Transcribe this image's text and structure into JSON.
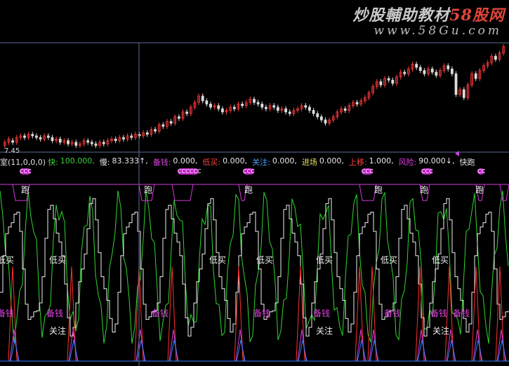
{
  "watermark": {
    "main_text": "炒股輔助教材",
    "brand_text": "58股网",
    "url": "www.58Gu.com"
  },
  "price_panel": {
    "min_label": "7.45",
    "candles_open_close": [
      [
        10,
        12
      ],
      [
        12,
        14
      ],
      [
        13,
        12
      ],
      [
        12,
        15
      ],
      [
        15,
        16
      ],
      [
        16,
        15
      ],
      [
        15,
        17
      ],
      [
        17,
        16
      ],
      [
        16,
        15
      ],
      [
        15,
        14
      ],
      [
        14,
        16
      ],
      [
        16,
        15
      ],
      [
        15,
        13
      ],
      [
        13,
        14
      ],
      [
        14,
        12
      ],
      [
        12,
        13
      ],
      [
        13,
        11
      ],
      [
        11,
        12
      ],
      [
        12,
        10
      ],
      [
        10,
        11
      ],
      [
        11,
        13
      ],
      [
        13,
        12
      ],
      [
        12,
        11
      ],
      [
        11,
        10
      ],
      [
        10,
        12
      ],
      [
        12,
        11
      ],
      [
        11,
        13
      ],
      [
        13,
        14
      ],
      [
        14,
        13
      ],
      [
        13,
        15
      ],
      [
        15,
        14
      ],
      [
        14,
        16
      ],
      [
        16,
        15
      ],
      [
        15,
        17
      ],
      [
        17,
        16
      ],
      [
        16,
        18
      ],
      [
        18,
        17
      ],
      [
        17,
        20
      ],
      [
        20,
        19
      ],
      [
        19,
        23
      ],
      [
        23,
        22
      ],
      [
        22,
        25
      ],
      [
        25,
        24
      ],
      [
        24,
        28
      ],
      [
        28,
        27
      ],
      [
        27,
        31
      ],
      [
        31,
        30
      ],
      [
        30,
        34
      ],
      [
        34,
        37
      ],
      [
        37,
        41
      ],
      [
        41,
        38
      ],
      [
        38,
        36
      ],
      [
        36,
        34
      ],
      [
        34,
        35
      ],
      [
        35,
        33
      ],
      [
        33,
        31
      ],
      [
        31,
        32
      ],
      [
        32,
        34
      ],
      [
        34,
        33
      ],
      [
        33,
        36
      ],
      [
        36,
        35
      ],
      [
        35,
        37
      ],
      [
        37,
        39
      ],
      [
        39,
        37
      ],
      [
        37,
        36
      ],
      [
        36,
        34
      ],
      [
        34,
        33
      ],
      [
        33,
        35
      ],
      [
        35,
        34
      ],
      [
        34,
        32
      ],
      [
        32,
        33
      ],
      [
        33,
        31
      ],
      [
        31,
        30
      ],
      [
        30,
        32
      ],
      [
        32,
        33
      ],
      [
        33,
        35
      ],
      [
        35,
        34
      ],
      [
        34,
        32
      ],
      [
        32,
        30
      ],
      [
        30,
        28
      ],
      [
        28,
        26
      ],
      [
        26,
        24
      ],
      [
        24,
        26
      ],
      [
        26,
        28
      ],
      [
        28,
        31
      ],
      [
        31,
        33
      ],
      [
        33,
        32
      ],
      [
        32,
        35
      ],
      [
        35,
        37
      ],
      [
        37,
        36
      ],
      [
        36,
        38
      ],
      [
        38,
        40
      ],
      [
        40,
        43
      ],
      [
        43,
        47
      ],
      [
        47,
        50
      ],
      [
        50,
        48
      ],
      [
        48,
        52
      ],
      [
        52,
        51
      ],
      [
        51,
        49
      ],
      [
        49,
        53
      ],
      [
        53,
        56
      ],
      [
        56,
        55
      ],
      [
        55,
        58
      ],
      [
        58,
        61
      ],
      [
        61,
        59
      ],
      [
        59,
        57
      ],
      [
        57,
        55
      ],
      [
        55,
        58
      ],
      [
        58,
        56
      ],
      [
        56,
        54
      ],
      [
        54,
        57
      ],
      [
        57,
        60
      ],
      [
        60,
        58
      ],
      [
        58,
        55
      ],
      [
        55,
        42
      ],
      [
        42,
        45
      ],
      [
        45,
        40
      ],
      [
        40,
        48
      ],
      [
        48,
        55
      ],
      [
        55,
        52
      ],
      [
        52,
        57
      ],
      [
        57,
        60
      ],
      [
        60,
        62
      ],
      [
        62,
        66
      ],
      [
        66,
        64
      ],
      [
        64,
        68
      ],
      [
        68,
        72
      ]
    ]
  },
  "header": {
    "items": [
      {
        "label": "室(11,0,0,0)",
        "value": "",
        "color": "#e0e0e0"
      },
      {
        "label": "快:",
        "value": "100.000,",
        "color": "#3fd13f"
      },
      {
        "label": "慢:",
        "value": "83.333↑,",
        "color": "#e8e8e8"
      },
      {
        "label": "备钱:",
        "value": "0.000,",
        "color": "#e040e0"
      },
      {
        "label": "低买:",
        "value": "0.000,",
        "color": "#ff4040"
      },
      {
        "label": "关注:",
        "value": "0.000,",
        "color": "#4fa0ff"
      },
      {
        "label": "进场",
        "value": "0.000,",
        "color": "#e8e060"
      },
      {
        "label": "上移:",
        "value": "1.000,",
        "color": "#ff4040"
      },
      {
        "label": "风险:",
        "value": "90.000↓,",
        "color": "#e040e0"
      },
      {
        "label": "快跑",
        "value": "",
        "color": "#e0e0e0"
      }
    ]
  },
  "indicator": {
    "pill_text": "CCCCCCCC",
    "labels_pao": "跑",
    "labels_dimai": "低买",
    "labels_beiqian": "备钱",
    "labels_guanzhu": "关注"
  },
  "colors": {
    "up": "#ff3b3b",
    "down": "#dcdcdc",
    "fast": "#2fd62f",
    "slow": "#f0f0f0",
    "magenta": "#d23ad8",
    "grid": "#5a6d96",
    "blue": "#2f7fff"
  }
}
